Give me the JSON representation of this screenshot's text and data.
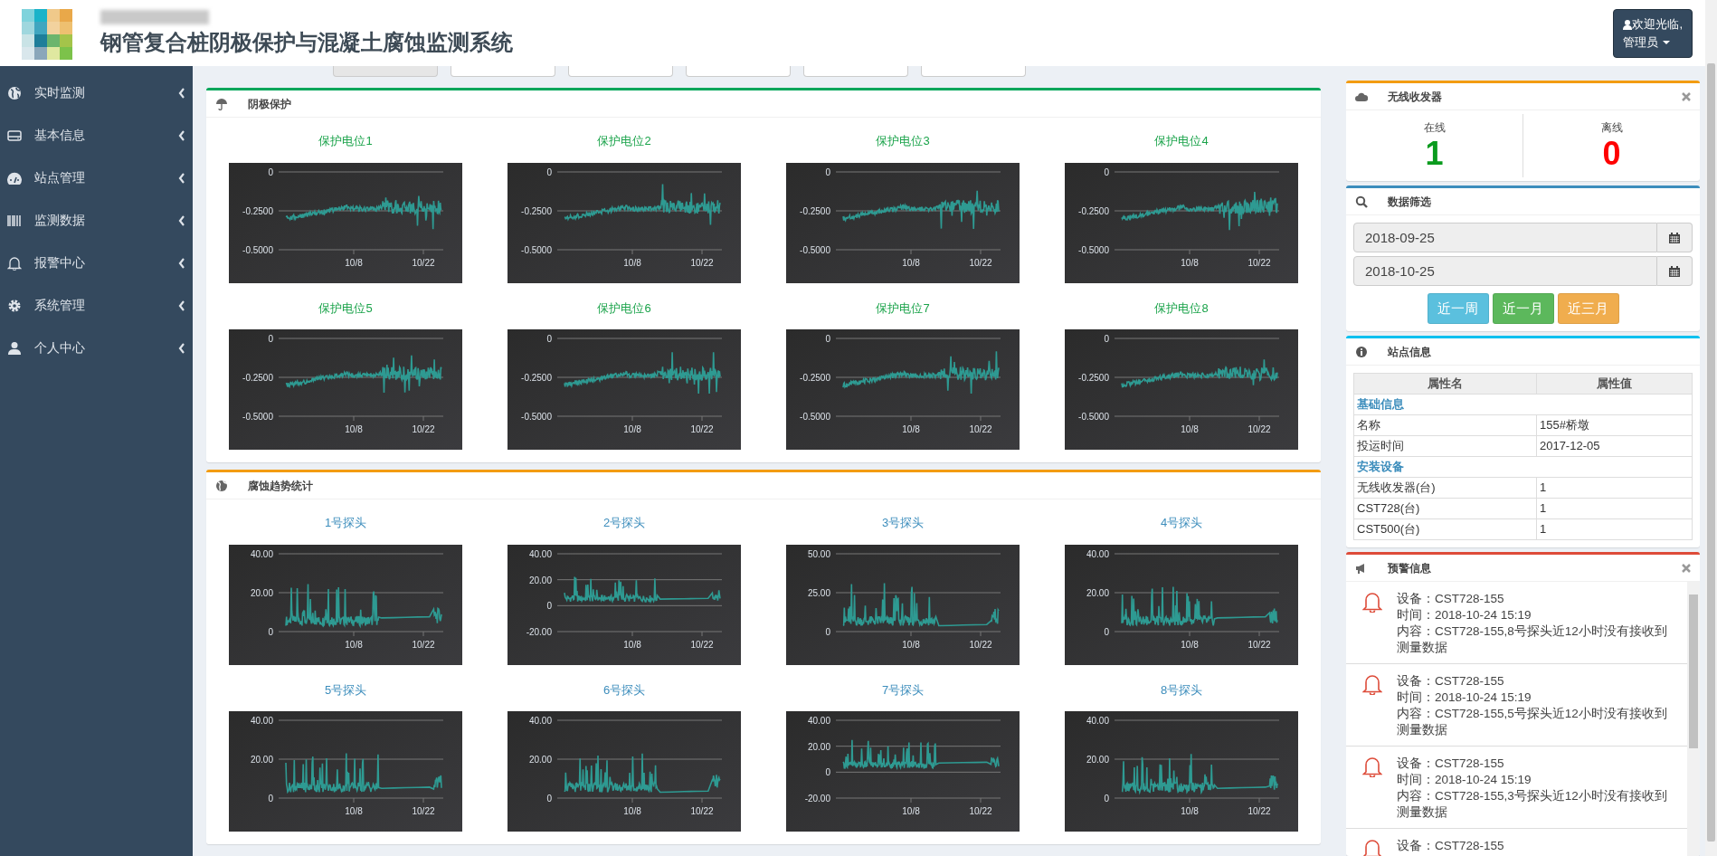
{
  "header": {
    "title": "钢管复合桩阴极保护与混凝土腐蚀监测系统",
    "user_menu": {
      "greeting": "欢迎光临,",
      "name": "管理员"
    }
  },
  "sidebar": {
    "items": [
      {
        "label": "实时监测"
      },
      {
        "label": "基本信息"
      },
      {
        "label": "站点管理"
      },
      {
        "label": "监测数据"
      },
      {
        "label": "报警中心"
      },
      {
        "label": "系统管理"
      },
      {
        "label": "个人中心"
      }
    ]
  },
  "top_tabs": [
    {
      "selected": true
    },
    {
      "selected": false
    },
    {
      "selected": false
    },
    {
      "selected": false
    },
    {
      "selected": false
    },
    {
      "selected": false
    }
  ],
  "cathodic_panel": {
    "title": "阴极保护",
    "charts": [
      {
        "title": "保护电位1",
        "yticks": [
          "0",
          "-0.2500",
          "-0.5000"
        ],
        "xticks": [
          "10/8",
          "10/22"
        ]
      },
      {
        "title": "保护电位2",
        "yticks": [
          "0",
          "-0.2500",
          "-0.5000"
        ],
        "xticks": [
          "10/8",
          "10/22"
        ]
      },
      {
        "title": "保护电位3",
        "yticks": [
          "0",
          "-0.2500",
          "-0.5000"
        ],
        "xticks": [
          "10/8",
          "10/22"
        ]
      },
      {
        "title": "保护电位4",
        "yticks": [
          "0",
          "-0.2500",
          "-0.5000"
        ],
        "xticks": [
          "10/8",
          "10/22"
        ]
      },
      {
        "title": "保护电位5",
        "yticks": [
          "0",
          "-0.2500",
          "-0.5000"
        ],
        "xticks": [
          "10/8",
          "10/22"
        ]
      },
      {
        "title": "保护电位6",
        "yticks": [
          "0",
          "-0.2500",
          "-0.5000"
        ],
        "xticks": [
          "10/8",
          "10/22"
        ]
      },
      {
        "title": "保护电位7",
        "yticks": [
          "0",
          "-0.2500",
          "-0.5000"
        ],
        "xticks": [
          "10/8",
          "10/22"
        ]
      },
      {
        "title": "保护电位8",
        "yticks": [
          "0",
          "-0.2500",
          "-0.5000"
        ],
        "xticks": [
          "10/8",
          "10/22"
        ]
      }
    ]
  },
  "corrosion_panel": {
    "title": "腐蚀趋势统计",
    "charts": [
      {
        "title": "1号探头",
        "yticks": [
          "40.00",
          "20.00",
          "0"
        ],
        "xticks": [
          "10/8",
          "10/22"
        ]
      },
      {
        "title": "2号探头",
        "yticks": [
          "40.00",
          "20.00",
          "0",
          "-20.00"
        ],
        "xticks": [
          "10/8",
          "10/22"
        ]
      },
      {
        "title": "3号探头",
        "yticks": [
          "50.00",
          "25.00",
          "0"
        ],
        "xticks": [
          "10/8",
          "10/22"
        ]
      },
      {
        "title": "4号探头",
        "yticks": [
          "40.00",
          "20.00",
          "0"
        ],
        "xticks": [
          "10/8",
          "10/22"
        ]
      },
      {
        "title": "5号探头",
        "yticks": [
          "40.00",
          "20.00",
          "0"
        ],
        "xticks": [
          "10/8",
          "10/22"
        ]
      },
      {
        "title": "6号探头",
        "yticks": [
          "40.00",
          "20.00",
          "0"
        ],
        "xticks": [
          "10/8",
          "10/22"
        ]
      },
      {
        "title": "7号探头",
        "yticks": [
          "40.00",
          "20.00",
          "0",
          "-20.00"
        ],
        "xticks": [
          "10/8",
          "10/22"
        ]
      },
      {
        "title": "8号探头",
        "yticks": [
          "40.00",
          "20.00",
          "0"
        ],
        "xticks": [
          "10/8",
          "10/22"
        ]
      }
    ]
  },
  "wireless_panel": {
    "title": "无线收发器",
    "stats": [
      {
        "label": "在线",
        "count": "1",
        "color": "#0a9b1e"
      },
      {
        "label": "离线",
        "count": "0",
        "color": "#ff0000"
      }
    ]
  },
  "filter_panel": {
    "title": "数据筛选",
    "start_date": "2018-09-25",
    "end_date": "2018-10-25",
    "buttons": [
      {
        "label": "近一周",
        "color": "#5bc0de"
      },
      {
        "label": "近一月",
        "color": "#5cb85c"
      },
      {
        "label": "近三月",
        "color": "#f0ad4e"
      }
    ]
  },
  "station_panel": {
    "title": "站点信息",
    "columns": [
      "属性名",
      "属性值"
    ],
    "rows": [
      {
        "kind": "group",
        "label": "基础信息"
      },
      {
        "kind": "row",
        "name": "名称",
        "value": "155#桥墩"
      },
      {
        "kind": "row",
        "name": "投运时间",
        "value": "2017-12-05"
      },
      {
        "kind": "group",
        "label": "安装设备"
      },
      {
        "kind": "row",
        "name": "无线收发器(台)",
        "value": "1"
      },
      {
        "kind": "row",
        "name": "CST728(台)",
        "value": "1"
      },
      {
        "kind": "row",
        "name": "CST500(台)",
        "value": "1"
      }
    ]
  },
  "alert_panel": {
    "title": "预警信息",
    "alerts": [
      {
        "device": "设备：CST728-155",
        "time": "时间：2018-10-24 15:19",
        "content": "内容：CST728-155,8号探头近12小时没有接收到测量数据"
      },
      {
        "device": "设备：CST728-155",
        "time": "时间：2018-10-24 15:19",
        "content": "内容：CST728-155,5号探头近12小时没有接收到测量数据"
      },
      {
        "device": "设备：CST728-155",
        "time": "时间：2018-10-24 15:19",
        "content": "内容：CST728-155,3号探头近12小时没有接收到测量数据"
      },
      {
        "device": "设备：CST728-155"
      }
    ]
  }
}
